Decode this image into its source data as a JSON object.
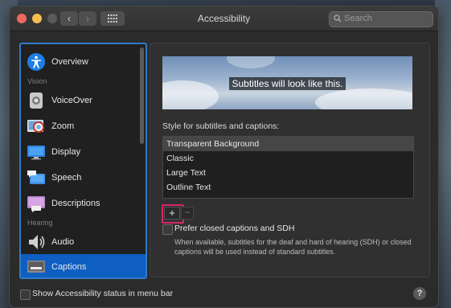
{
  "window": {
    "title": "Accessibility"
  },
  "toolbar": {
    "back": "‹",
    "forward": "›",
    "search_placeholder": "Search"
  },
  "sidebar": {
    "items": [
      {
        "label": "Overview"
      },
      {
        "label": "VoiceOver"
      },
      {
        "label": "Zoom"
      },
      {
        "label": "Display"
      },
      {
        "label": "Speech"
      },
      {
        "label": "Descriptions"
      },
      {
        "label": "Audio"
      },
      {
        "label": "Captions"
      }
    ],
    "sections": {
      "vision": "Vision",
      "hearing": "Hearing"
    },
    "selected": "Captions"
  },
  "main": {
    "preview_text": "Subtitles will look like this.",
    "style_label": "Style for subtitles and captions:",
    "styles": [
      "Transparent Background",
      "Classic",
      "Large Text",
      "Outline Text"
    ],
    "selected_style": "Transparent Background",
    "add": "+",
    "remove": "−",
    "prefer_cc_label": "Prefer closed captions and SDH",
    "prefer_cc_checked": false,
    "prefer_cc_desc": "When available, subtitles for the deaf and hard of hearing (SDH) or closed captions will be used instead of standard subtitles."
  },
  "footer": {
    "status_label": "Show Accessibility status in menu bar",
    "status_checked": false,
    "help": "?"
  },
  "colors": {
    "accent": "#0f5fc3",
    "highlight": "#d8256b"
  }
}
